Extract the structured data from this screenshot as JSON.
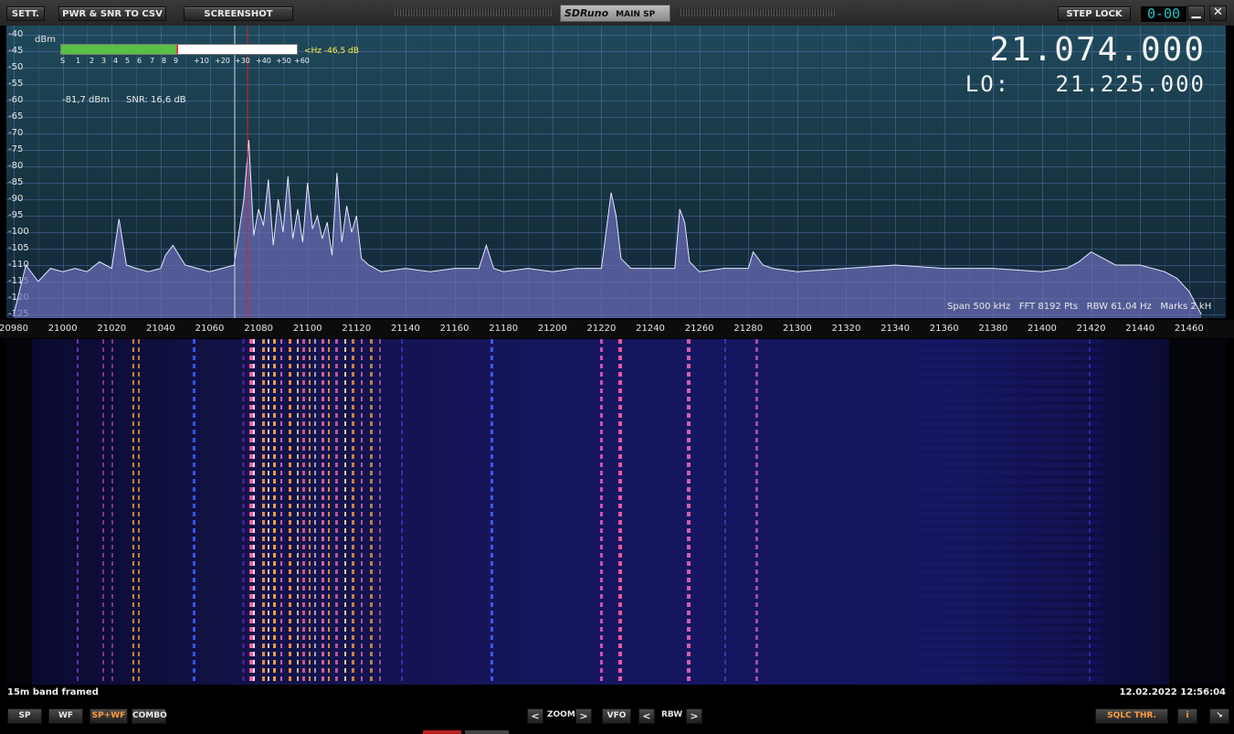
{
  "toolbar": {
    "sett": "SETT.",
    "pwr_csv": "PWR & SNR TO CSV",
    "screenshot": "SCREENSHOT",
    "brand": "SDRuno",
    "panel": "MAIN SP",
    "step_lock": "STEP LOCK",
    "clock": "0-00",
    "minimize": "▁",
    "close": "✕"
  },
  "spectrum": {
    "unit": "dBm",
    "y_ticks": [
      "-40",
      "-45",
      "-50",
      "-55",
      "-60",
      "-65",
      "-70",
      "-75",
      "-80",
      "-85",
      "-90",
      "-95",
      "-100",
      "-105",
      "-110",
      "-115",
      "-120",
      "-125"
    ],
    "smeter_scale": [
      "S",
      "1",
      "2",
      "3",
      "4",
      "5",
      "6",
      "7",
      "8",
      "9",
      "+10",
      "+20",
      "+30",
      "+40",
      "+50",
      "+60"
    ],
    "smeter_level": 0.49,
    "hz_readout": "<Hz -46,5 dB",
    "power": "-81,7 dBm",
    "snr": "SNR: 16,6 dB",
    "vfo_freq": "21.074.000",
    "lo_label": "LO:",
    "lo_freq": "21.225.000",
    "span": "Span 500 kHz",
    "fft": "FFT 8192 Pts",
    "rbw": "RBW 61,04 Hz",
    "marks": "Marks 2 kH",
    "x_ticks": [
      "20980",
      "21000",
      "21020",
      "21040",
      "21060",
      "21080",
      "21100",
      "21120",
      "21140",
      "21160",
      "21180",
      "21200",
      "21220",
      "21240",
      "21260",
      "21280",
      "21300",
      "21320",
      "21340",
      "21360",
      "21380",
      "21400",
      "21420",
      "21440",
      "21460"
    ]
  },
  "chart_data": {
    "type": "line",
    "xlabel": "",
    "ylabel": "dBm",
    "xlim": [
      20977,
      21475
    ],
    "ylim": [
      -125,
      -40
    ],
    "x": [
      20980,
      20985,
      20990,
      20995,
      21000,
      21005,
      21010,
      21015,
      21020,
      21023,
      21026,
      21030,
      21035,
      21040,
      21042,
      21045,
      21050,
      21055,
      21060,
      21065,
      21070,
      21074,
      21076,
      21078,
      21080,
      21082,
      21084,
      21086,
      21088,
      21090,
      21092,
      21094,
      21096,
      21098,
      21100,
      21102,
      21104,
      21106,
      21108,
      21110,
      21112,
      21114,
      21116,
      21118,
      21120,
      21122,
      21125,
      21130,
      21140,
      21150,
      21160,
      21170,
      21173,
      21176,
      21180,
      21190,
      21200,
      21210,
      21220,
      21224,
      21226,
      21228,
      21232,
      21240,
      21250,
      21252,
      21254,
      21256,
      21260,
      21270,
      21280,
      21282,
      21286,
      21290,
      21300,
      21320,
      21340,
      21360,
      21380,
      21400,
      21410,
      21415,
      21420,
      21430,
      21440,
      21450,
      21455,
      21460,
      21465
    ],
    "series": [
      {
        "values": [
          -125,
          -110,
          -115,
          -111,
          -112,
          -111,
          -112,
          -109,
          -111,
          -96,
          -110,
          -111,
          -112,
          -111,
          -107,
          -104,
          -110,
          -111,
          -112,
          -111,
          -110,
          -90,
          -72,
          -101,
          -93,
          -98,
          -84,
          -104,
          -90,
          -100,
          -83,
          -102,
          -93,
          -103,
          -85,
          -99,
          -95,
          -102,
          -97,
          -107,
          -82,
          -103,
          -92,
          -100,
          -95,
          -108,
          -110,
          -112,
          -111,
          -112,
          -111,
          -111,
          -104,
          -111,
          -112,
          -111,
          -112,
          -111,
          -111,
          -88,
          -95,
          -108,
          -111,
          -111,
          -111,
          -93,
          -97,
          -109,
          -112,
          -111,
          -111,
          -106,
          -110,
          -111,
          -112,
          -111,
          -110,
          -111,
          -111,
          -112,
          -111,
          -109,
          -106,
          -110,
          -110,
          -112,
          -114,
          -118,
          -125
        ]
      }
    ]
  },
  "waterfall": {
    "label": "15m band framed",
    "timestamp": "12.02.2022 12:56:04"
  },
  "bottom": {
    "sp": "SP",
    "wf": "WF",
    "spwf": "SP+WF",
    "combo": "COMBO",
    "prev": "<",
    "zoom": "ZOOM",
    "next": ">",
    "vfo": "VFO",
    "rbw_prev": "<",
    "rbw": "RBW",
    "rbw_next": ">",
    "sqlc": "SQLC THR.",
    "info": "i",
    "resize": "↘"
  },
  "colors": {
    "accent": "#ff9a3c",
    "meter": "#5bbf45",
    "spectrum_fill": "#6b6eb8"
  }
}
